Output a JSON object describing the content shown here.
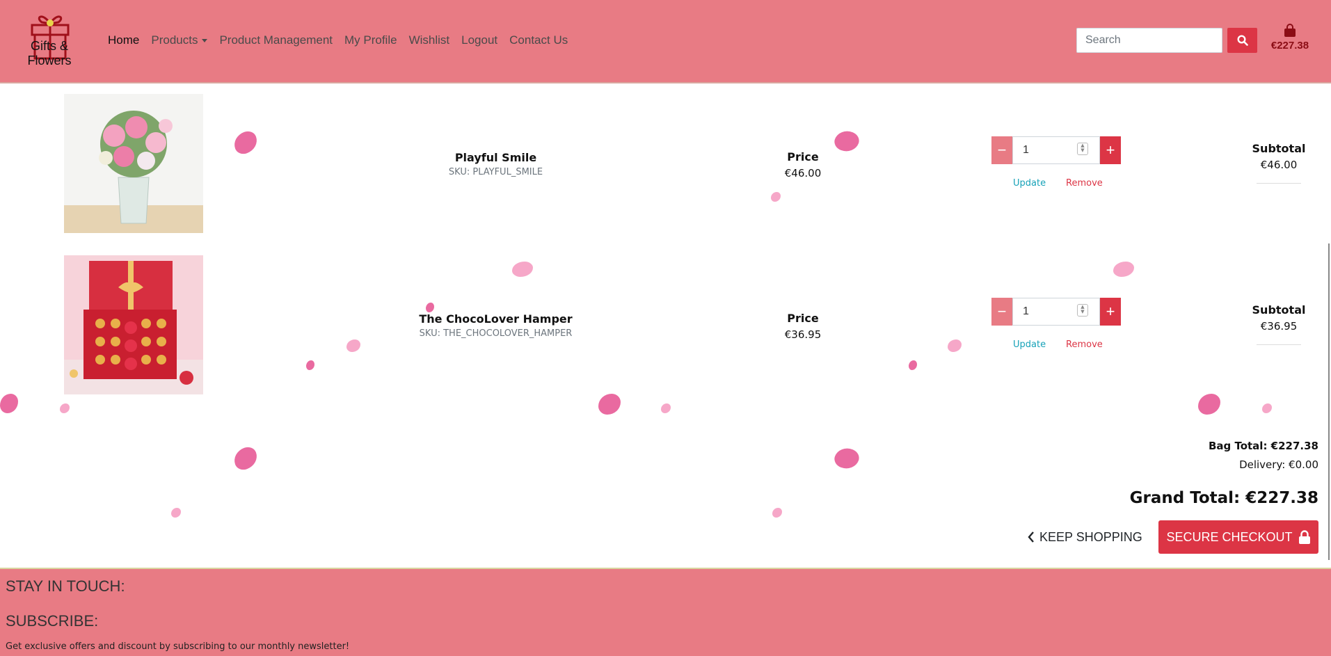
{
  "brand": {
    "name": "Gifts & Flowers"
  },
  "nav": {
    "items": [
      {
        "label": "Home",
        "active": true
      },
      {
        "label": "Products",
        "dropdown": true
      },
      {
        "label": "Product Management"
      },
      {
        "label": "My Profile"
      },
      {
        "label": "Wishlist"
      },
      {
        "label": "Logout"
      },
      {
        "label": "Contact Us"
      }
    ]
  },
  "search": {
    "placeholder": "Search",
    "icon": "search-icon"
  },
  "bag": {
    "icon": "shopping-bag-icon",
    "total": "€227.38"
  },
  "cart": {
    "price_label": "Price",
    "subtotal_label": "Subtotal",
    "update_label": "Update",
    "remove_label": "Remove",
    "items": [
      {
        "name": "Playful Smile",
        "sku": "SKU: PLAYFUL_SMILE",
        "price": "€46.00",
        "quantity": "1",
        "subtotal": "€46.00"
      },
      {
        "name": "The ChocoLover Hamper",
        "sku": "SKU: THE_CHOCOLOVER_HAMPER",
        "price": "€36.95",
        "quantity": "1",
        "subtotal": "€36.95"
      }
    ]
  },
  "totals": {
    "bag_total": "Bag Total: €227.38",
    "delivery": "Delivery: €0.00",
    "grand_total": "Grand Total: €227.38"
  },
  "actions": {
    "keep_shopping": "Keep Shopping",
    "secure_checkout": "Secure Checkout"
  },
  "footer": {
    "stay_in_touch": "Stay in touch:",
    "subscribe": "Subscribe:",
    "subscribe_text": "Get exclusive offers and discount by subscribing to our monthly newsletter!"
  },
  "colors": {
    "header_bg": "#e87b84",
    "accent": "#dc3545",
    "bag_text": "#8b0d15",
    "update_link": "#17a2b8"
  }
}
